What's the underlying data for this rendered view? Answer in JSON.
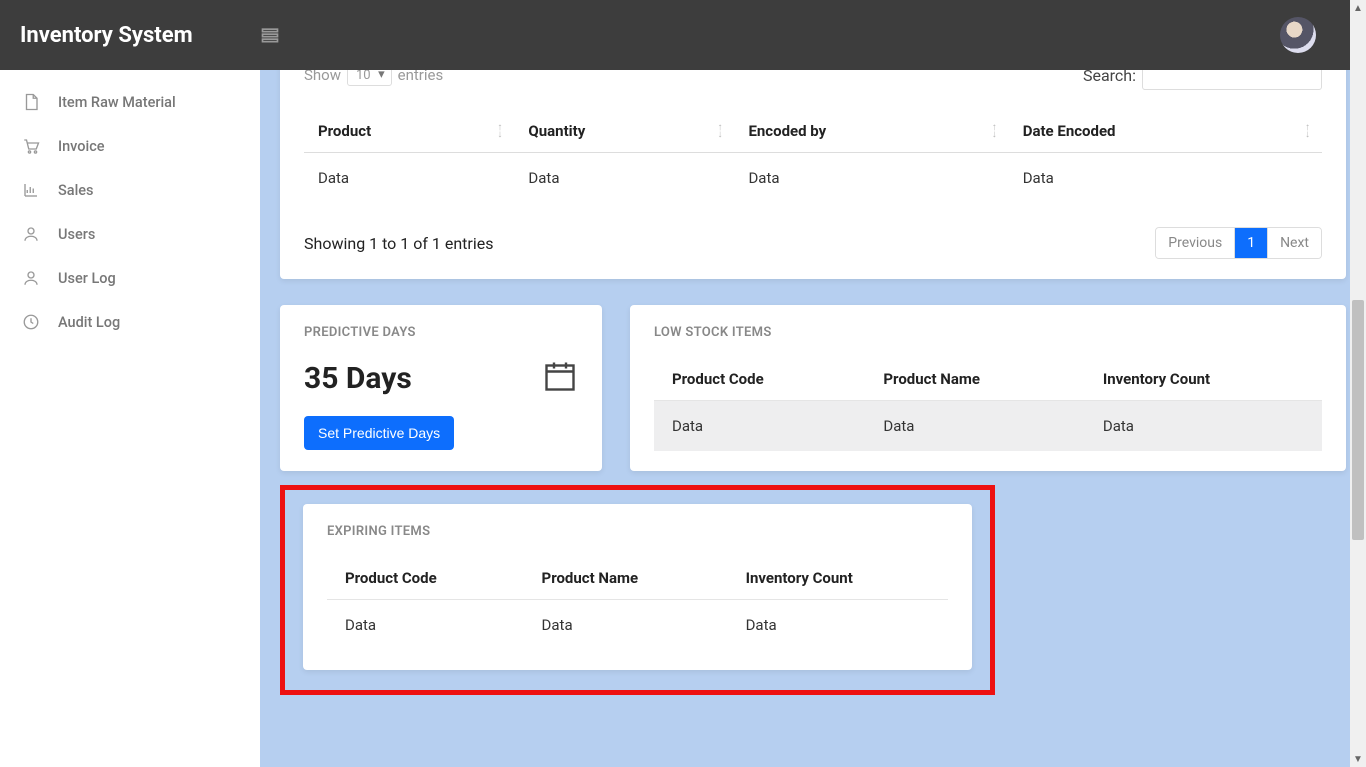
{
  "app": {
    "title": "Inventory System"
  },
  "sidebar": {
    "items": [
      {
        "label": "Item Raw Material",
        "icon": "file"
      },
      {
        "label": "Invoice",
        "icon": "cart"
      },
      {
        "label": "Sales",
        "icon": "chart"
      },
      {
        "label": "Users",
        "icon": "user"
      },
      {
        "label": "User Log",
        "icon": "user"
      },
      {
        "label": "Audit Log",
        "icon": "clock"
      }
    ]
  },
  "datatable": {
    "show_label": "Show",
    "entries_label": "entries",
    "page_size": "10",
    "search_label": "Search:",
    "columns": [
      "Product",
      "Quantity",
      "Encoded by",
      "Date Encoded"
    ],
    "rows": [
      [
        "Data",
        "Data",
        "Data",
        "Data"
      ]
    ],
    "info": "Showing 1 to 1 of 1 entries",
    "pagination": {
      "prev": "Previous",
      "page": "1",
      "next": "Next"
    }
  },
  "predictive": {
    "title": "PREDICTIVE DAYS",
    "value": "35 Days",
    "button": "Set Predictive Days"
  },
  "lowstock": {
    "title": "LOW STOCK ITEMS",
    "columns": [
      "Product Code",
      "Product Name",
      "Inventory Count"
    ],
    "rows": [
      [
        "Data",
        "Data",
        "Data"
      ]
    ]
  },
  "expiring": {
    "title": "EXPIRING ITEMS",
    "columns": [
      "Product Code",
      "Product Name",
      "Inventory Count"
    ],
    "rows": [
      [
        "Data",
        "Data",
        "Data"
      ]
    ]
  }
}
